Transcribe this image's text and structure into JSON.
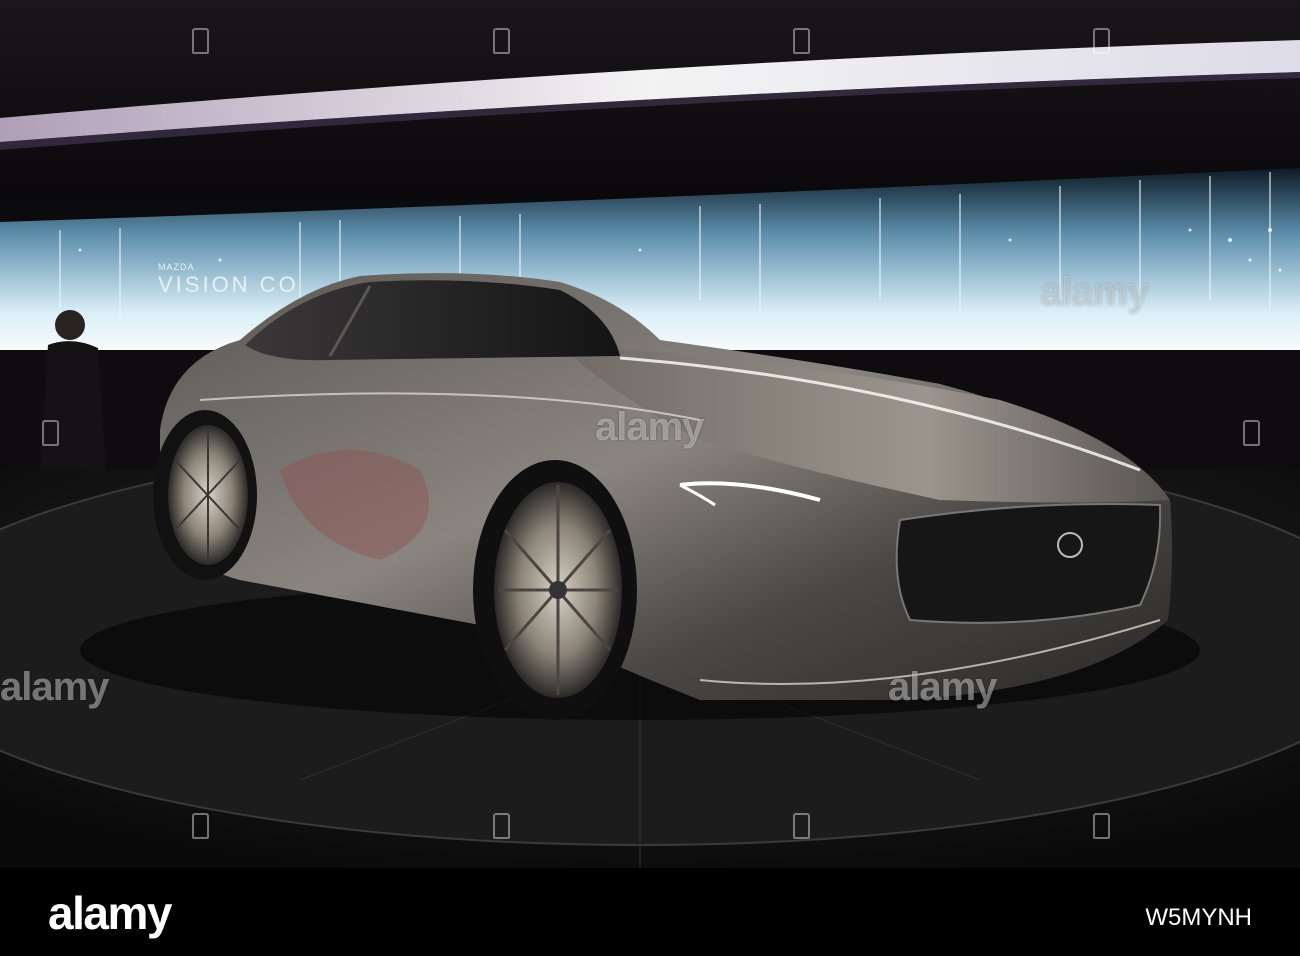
{
  "photo": {
    "screen_brand": "MAZDA",
    "screen_title": "VISION CO",
    "description_colors": {
      "background": "#0b0a0c",
      "screen_glow": "#c9e6f2",
      "car_body": "#6d6a66",
      "floor": "#141414"
    }
  },
  "watermarks": {
    "text": "alamy",
    "icon": "alamy-logo-icon"
  },
  "footer": {
    "logo": "alamy",
    "image_id": "W5MYNH"
  }
}
